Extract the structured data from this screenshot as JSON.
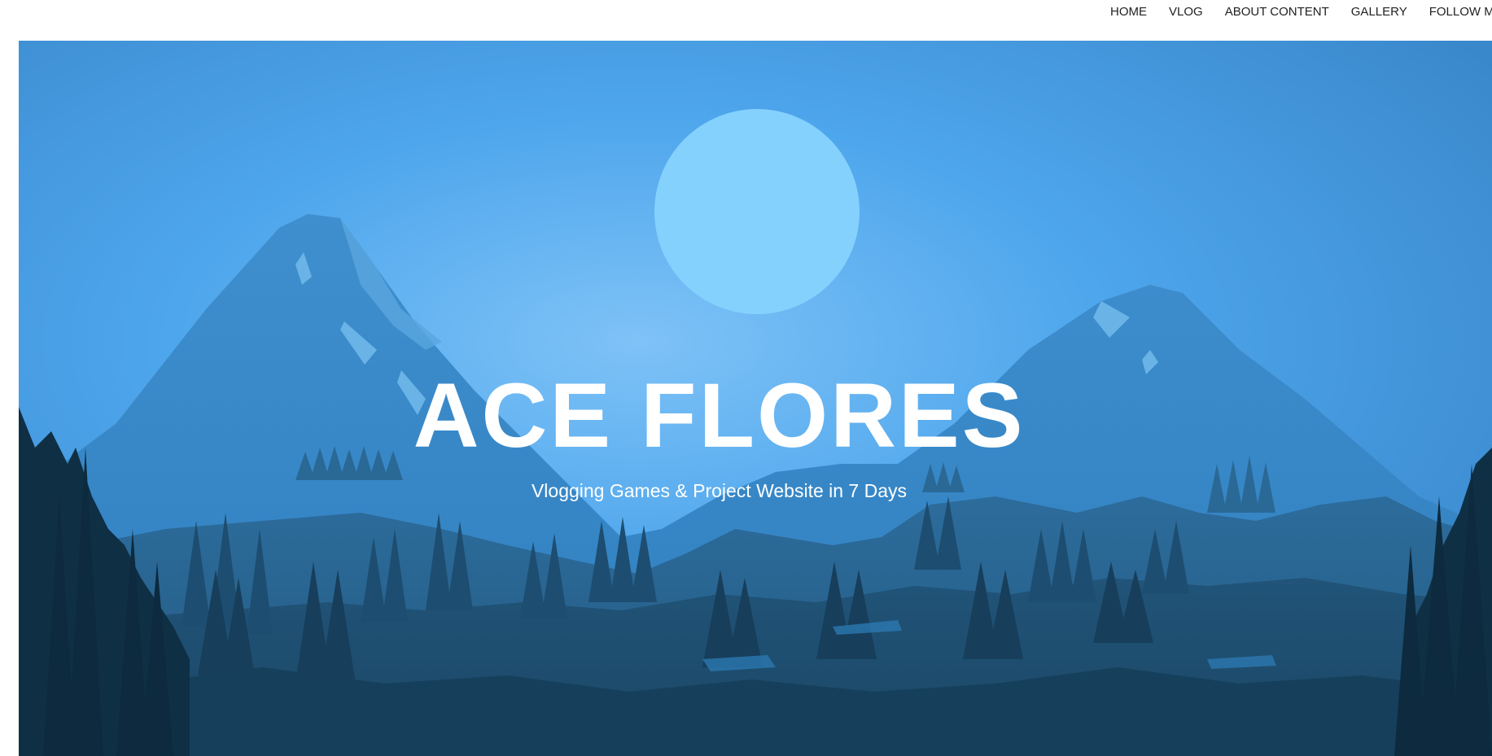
{
  "nav": {
    "items": [
      {
        "label": "HOME"
      },
      {
        "label": "VLOG"
      },
      {
        "label": "ABOUT CONTENT"
      },
      {
        "label": "GALLERY"
      },
      {
        "label": "FOLLOW ME"
      }
    ]
  },
  "hero": {
    "title": "ACE FLORES",
    "subtitle": "Vlogging Games & Project Website in 7 Days"
  },
  "colors": {
    "sky_top": "#3f8dd0",
    "sky_mid": "#4aa3e8",
    "moon": "#85d1fe",
    "mountain_far": "#3b8ccc",
    "mountain_mid": "#2e6f9f",
    "forest_dark": "#143a55",
    "text": "#ffffff"
  }
}
